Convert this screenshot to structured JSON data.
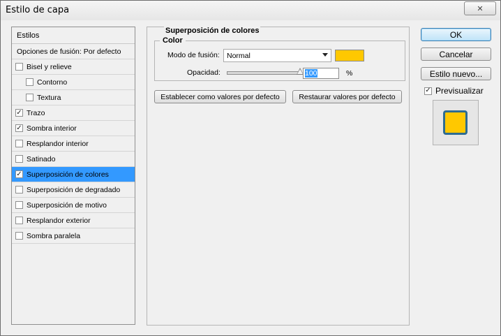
{
  "window": {
    "title": "Estilo de capa",
    "close_symbol": "✕"
  },
  "left_panel": {
    "header": "Estilos",
    "blend_options": "Opciones de fusión: Por defecto",
    "items": [
      {
        "label": "Bisel y relieve",
        "checked": false,
        "indent": false,
        "selected": false
      },
      {
        "label": "Contorno",
        "checked": false,
        "indent": true,
        "selected": false
      },
      {
        "label": "Textura",
        "checked": false,
        "indent": true,
        "selected": false
      },
      {
        "label": "Trazo",
        "checked": true,
        "indent": false,
        "selected": false
      },
      {
        "label": "Sombra interior",
        "checked": true,
        "indent": false,
        "selected": false
      },
      {
        "label": "Resplandor interior",
        "checked": false,
        "indent": false,
        "selected": false
      },
      {
        "label": "Satinado",
        "checked": false,
        "indent": false,
        "selected": false
      },
      {
        "label": "Superposición de colores",
        "checked": true,
        "indent": false,
        "selected": true
      },
      {
        "label": "Superposición de degradado",
        "checked": false,
        "indent": false,
        "selected": false
      },
      {
        "label": "Superposición de motivo",
        "checked": false,
        "indent": false,
        "selected": false
      },
      {
        "label": "Resplandor exterior",
        "checked": false,
        "indent": false,
        "selected": false
      },
      {
        "label": "Sombra paralela",
        "checked": false,
        "indent": false,
        "selected": false
      }
    ]
  },
  "main": {
    "section_title": "Superposición de colores",
    "color_group_title": "Color",
    "blend_mode_label": "Modo de fusión:",
    "blend_mode_value": "Normal",
    "overlay_color": "#ffc800",
    "opacity_label": "Opacidad:",
    "opacity_value": "100",
    "opacity_unit": "%",
    "opacity_fraction": 1.0,
    "set_default_button": "Establecer como valores por defecto",
    "reset_default_button": "Restaurar valores por defecto"
  },
  "right_panel": {
    "ok_button": "OK",
    "cancel_button": "Cancelar",
    "new_style_button": "Estilo nuevo...",
    "preview_label": "Previsualizar",
    "preview_checked": true,
    "preview_fill": "#ffc800",
    "preview_stroke": "#2e6c91"
  },
  "colors": {
    "selection": "#3399ff"
  }
}
